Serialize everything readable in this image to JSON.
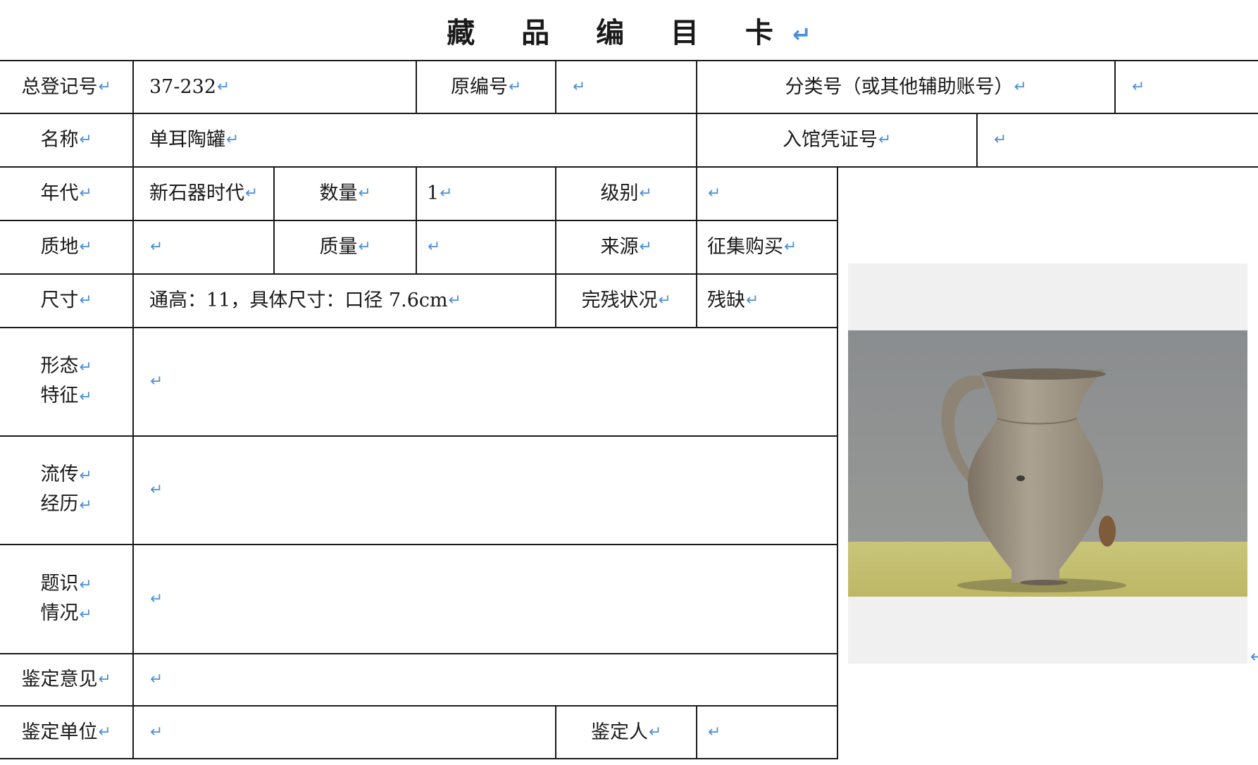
{
  "title": "藏 品 编 目 卡",
  "mark": "↵",
  "row1": {
    "reg_no_label": "总登记号",
    "reg_no_value": "37-232",
    "orig_no_label": "原编号",
    "orig_no_value": "",
    "class_no_label": "分类号（或其他辅助账号）",
    "class_no_value": ""
  },
  "row2": {
    "name_label": "名称",
    "name_value": "单耳陶罐",
    "voucher_label": "入馆凭证号",
    "voucher_value": ""
  },
  "row3": {
    "era_label": "年代",
    "era_value": "新石器时代",
    "qty_label": "数量",
    "qty_value": "1",
    "grade_label": "级别",
    "grade_value": ""
  },
  "row4": {
    "material_label": "质地",
    "material_value": "",
    "weight_label": "质量",
    "weight_value": "",
    "source_label": "来源",
    "source_value": "征集购买"
  },
  "row5": {
    "size_label": "尺寸",
    "size_value": "通高：11，具体尺寸：口径 7.6cm",
    "condition_label": "完残状况",
    "condition_value": "残缺"
  },
  "row6": {
    "label_line1": "形态",
    "label_line2": "特征",
    "value": ""
  },
  "row7": {
    "label_line1": "流传",
    "label_line2": "经历",
    "value": ""
  },
  "row8": {
    "label_line1": "题识",
    "label_line2": "情况",
    "value": ""
  },
  "row9": {
    "label": "鉴定意见",
    "value": ""
  },
  "row10": {
    "unit_label": "鉴定单位",
    "unit_value": "",
    "appraiser_label": "鉴定人",
    "appraiser_value": ""
  },
  "colors": {
    "mark": "#4a8fd6",
    "line": "#1a1a1a",
    "photo_bg": "#f0f0f0"
  }
}
